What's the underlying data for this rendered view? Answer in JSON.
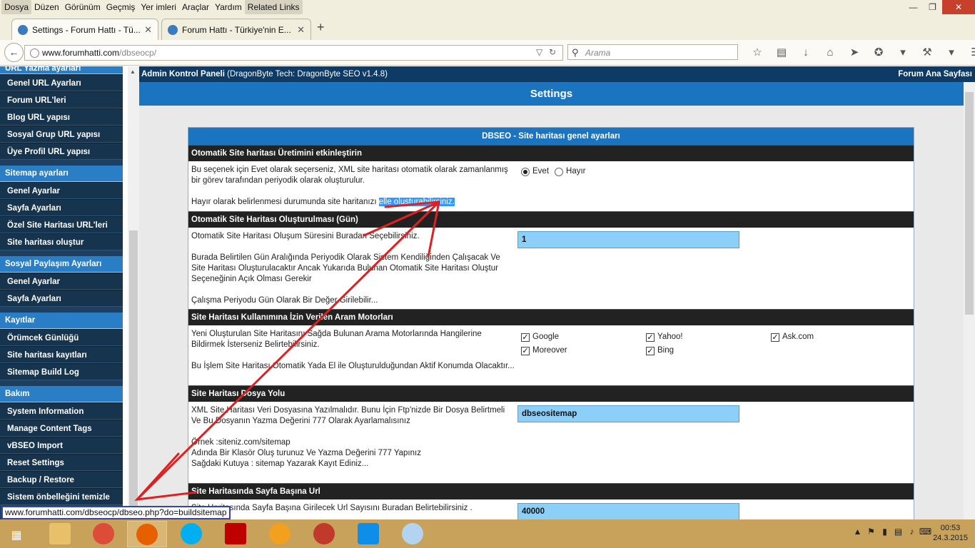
{
  "menubar": {
    "items": [
      "Dosya",
      "Düzen",
      "Görünüm",
      "Geçmiş",
      "Yer imleri",
      "Araçlar",
      "Yardım",
      "Related Links"
    ]
  },
  "tabs": [
    {
      "label": "Settings - Forum Hattı - Tü...",
      "active": true
    },
    {
      "label": "Forum Hattı - Türkiye'nin E...",
      "active": false
    }
  ],
  "newtab": "+",
  "url": {
    "host": "www.forumhatti.com",
    "path": "/dbseocp/"
  },
  "search": {
    "placeholder": "Arama"
  },
  "sidebar": {
    "top_item": "URL Yazma ayarları",
    "groups": [
      {
        "items": [
          "Genel URL Ayarları",
          "Forum URL'leri",
          "Blog URL yapısı",
          "Sosyal Grup URL yapısı",
          "Üye Profil URL yapısı"
        ]
      },
      {
        "title": "Sitemap ayarları",
        "items": [
          "Genel Ayarlar",
          "Sayfa Ayarları",
          "Özel Site Haritası URL'leri",
          "Site haritası oluştur"
        ]
      },
      {
        "title": "Sosyal Paylaşım Ayarları",
        "items": [
          "Genel Ayarlar",
          "Sayfa Ayarları"
        ]
      },
      {
        "title": "Kayıtlar",
        "items": [
          "Örümcek Günlüğü",
          "Site haritası kayıtları",
          "Sitemap Build Log"
        ]
      },
      {
        "title": "Bakım",
        "items": [
          "System Information",
          "Manage Content Tags",
          "vBSEO Import",
          "Reset Settings",
          "Backup / Restore",
          "Sistem önbelleğini temizle"
        ]
      }
    ]
  },
  "header": {
    "title": "Admin Kontrol Paneli",
    "subtitle": "(DragonByte Tech: DragonByte SEO v1.4.8)",
    "right_link": "Forum Ana Sayfası"
  },
  "settings_title": "Settings",
  "panel_title": "DBSEO - Site haritası genel ayarları",
  "sections": [
    {
      "heading": "Otomatik Site haritası Üretimini etkinleştirin",
      "desc1": "Bu seçenek için Evet olarak seçerseniz, XML site haritası otomatik olarak zamanlanmış bir görev tarafından periyodik olarak oluşturulur.",
      "desc2_plain": "Hayır olarak belirlenmesi durumunda site haritanızı ",
      "desc2_highlight": "elle oluşturabilirsiniz.",
      "options": [
        "Evet",
        "Hayır"
      ]
    },
    {
      "heading": "Otomatik Site Haritası Oluşturulması (Gün)",
      "desc1": "Otomatik Site Haritası Oluşum Süresini Buradan Seçebilirsiniz.",
      "desc2": "Burada Belirtilen Gün Aralığında Periyodik Olarak Sistem Kendiliğinden Çalışacak Ve Site Haritası Oluşturulacaktır Ancak Yukarıda Bulunan Otomatik Site Haritası Oluştur Seçeneğinin Açık Olması Gerekir",
      "desc3": "Çalışma Periyodu Gün Olarak Bir Değer Girilebilir...",
      "value": "1"
    },
    {
      "heading": "Site Haritası Kullanımına İzin Verilen Aram Motorları",
      "desc1": "Yeni Oluşturulan Site Haritasını Sağda Bulunan Arama Motorlarında Hangilerine Bildirmek İsterseniz Belirtebilirsiniz.",
      "desc2": "Bu İşlem Site Haritası Otomatik Yada El ile Oluşturulduğundan Aktif Konumda Olacaktır...",
      "engines": [
        "Google",
        "Yahoo!",
        "Ask.com",
        "Moreover",
        "Bing"
      ]
    },
    {
      "heading": "Site Haritası Dosya Yolu",
      "desc1": "XML Site Haritası Veri Dosyasına Yazılmalıdır. Bunu İçin Ftp'nizde Bir Dosya Belirtmeli Ve Bu Dosyanın Yazma Değerini 777 Olarak Ayarlamalısınız",
      "desc2a": "Örnek :siteniz.com/sitemap",
      "desc2b": "Adında Bir Klasör Oluş turunuz Ve Yazma Değerini 777 Yapınız",
      "desc2c": "Sağdaki Kutuya : sitemap Yazarak Kayıt Ediniz...",
      "value": "dbseositemap"
    },
    {
      "heading": "Site Haritasında Sayfa Başına Url",
      "desc1": "Site Haritasında Sayfa Başına Girilecek Url Sayısını Buradan Belirtebilirsiniz .",
      "value": "40000"
    }
  ],
  "status_url": "www.forumhatti.com/dbseocp/dbseo.php?do=buildsitemap",
  "clock": {
    "time": "00:53",
    "date": "24.3.2015"
  },
  "colors": {
    "sidebar": "#1e3f5f",
    "accent": "#1a74bf",
    "header": "#0d3b66",
    "taskbar": "#c8a15a",
    "annotation": "#e02020"
  }
}
